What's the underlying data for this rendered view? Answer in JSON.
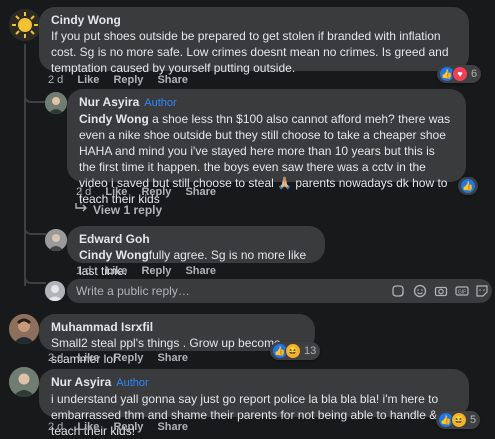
{
  "comments": [
    {
      "author": "Cindy Wong",
      "text": "If you put shoes outside be prepared to get stolen if branded with inflation cost. Sg is no more safe. Low crimes doesnt mean no crimes. Is greed and temptation caused by yourself putting outside.",
      "time": "2 d",
      "like": "Like",
      "reply": "Reply",
      "share": "Share",
      "reactions": {
        "icons": [
          "like-icon",
          "love-icon"
        ],
        "count": "6"
      }
    },
    {
      "author": "Nur Asyira",
      "badge": "Author",
      "mention": "Cindy Wong",
      "text": " a shoe less thn $100 also cannot afford meh? there was even a nike shoe outside but they still choose to take a cheaper shoe HAHA and mind you i've stayed here more than 10 years but this is the first time it happen. the boys even saw there was a cctv in the video i saved but still choose to steal 🙏🏼 parents nowadays dk how to teach their kids",
      "time": "2 d",
      "like": "Like",
      "reply": "Reply",
      "share": "Share",
      "reactions": {
        "icons": [
          "like-icon"
        ],
        "count": ""
      }
    },
    {
      "author": "Edward Goh",
      "mention": "Cindy Wong",
      "text": "fully agree. Sg is no more like last time.",
      "time": "1 d",
      "like": "Like",
      "reply": "Reply",
      "share": "Share"
    },
    {
      "author": "Muhammad Isrxfil",
      "text": "Small2 steal ppl's things . Grow up become scammer lol",
      "time": "2 d",
      "like": "Like",
      "reply": "Reply",
      "share": "Share",
      "reactions": {
        "icons": [
          "like-icon",
          "haha-icon"
        ],
        "count": "13"
      }
    },
    {
      "author": "Nur Asyira",
      "badge": "Author",
      "text": "i understand yall gonna say just go report police la bla bla bla! i'm here to embarrassed thm and shame their parents for not being able to handle & teach their kids!",
      "time": "2 d",
      "like": "Like",
      "reply": "Reply",
      "share": "Share",
      "reactions": {
        "icons": [
          "like-icon",
          "haha-icon"
        ],
        "count": "5"
      }
    }
  ],
  "view_replies": "View 1 reply",
  "reply_input": {
    "placeholder": "Write a public reply…"
  },
  "colors": {
    "background": "#18191a",
    "bubble": "#3a3b3c",
    "author_badge": "#2d88ff",
    "like": "#1877f2",
    "love": "#f33e58",
    "haha": "#f7b125"
  }
}
